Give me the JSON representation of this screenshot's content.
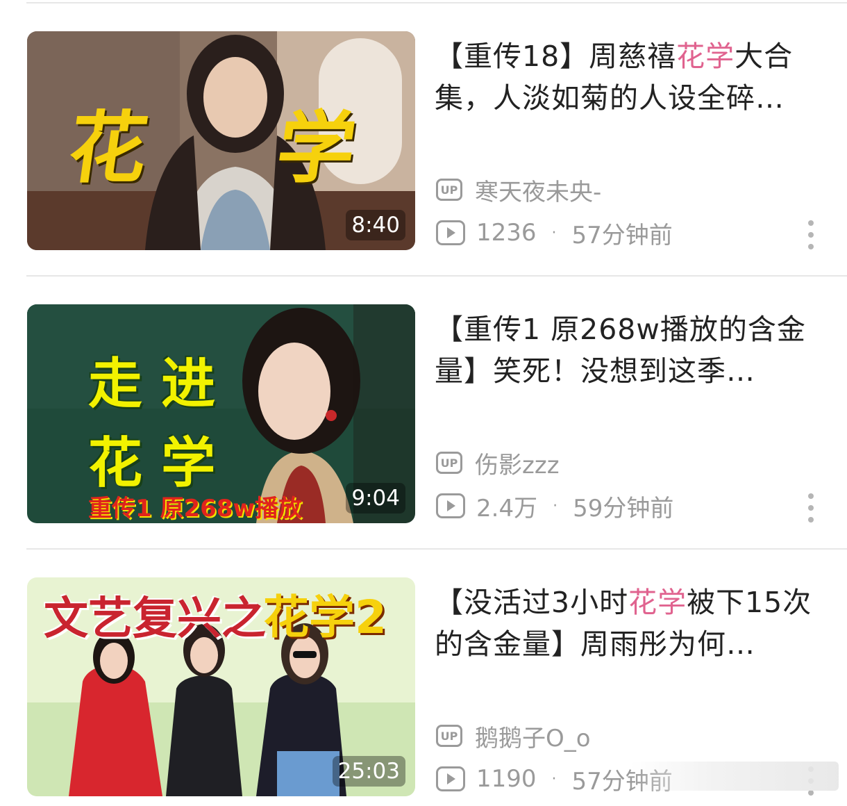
{
  "feed": {
    "videos": [
      {
        "title_pre": "【重传18】周慈禧",
        "title_hl": "花学",
        "title_post": "大合集，人淡如菊的人设全碎…",
        "thumb_text_1": "花",
        "thumb_text_2": "学",
        "thumb_text_3": "",
        "duration": "8:40",
        "uploader": "寒天夜未央-",
        "views": "1236",
        "time": "57分钟前",
        "thumb_colors": [
          "#6e5b50",
          "#b99d86",
          "#2f2622"
        ]
      },
      {
        "title_pre": "【重传1 原268w播放的含金量】笑死！没想到这季…",
        "title_hl": "",
        "title_post": "",
        "thumb_text_1": "走 进",
        "thumb_text_2": "花 学",
        "thumb_text_3": "重传1 原268w播放",
        "duration": "9:04",
        "uploader": "伤影zzz",
        "views": "2.4万",
        "time": "59分钟前",
        "thumb_colors": [
          "#1f4a3a",
          "#2f6a52",
          "#cbb48f"
        ]
      },
      {
        "title_pre": "【没活过3小时",
        "title_hl": "花学",
        "title_post": "被下15次的含金量】周雨彤为何…",
        "thumb_text_1": "文艺复兴之",
        "thumb_text_2": "花学2",
        "thumb_text_3": "",
        "duration": "25:03",
        "uploader": "鹅鹅子O_o",
        "views": "1190",
        "time": "57分钟前",
        "thumb_colors": [
          "#e3f0c9",
          "#bfe0a2",
          "#c9242f"
        ]
      }
    ],
    "dot_separator": "·",
    "up_badge": "UP",
    "icons": {
      "up": "up-badge-icon",
      "views": "play-count-icon",
      "more": "more-vertical-icon"
    },
    "accent_color": "#e0638f"
  }
}
